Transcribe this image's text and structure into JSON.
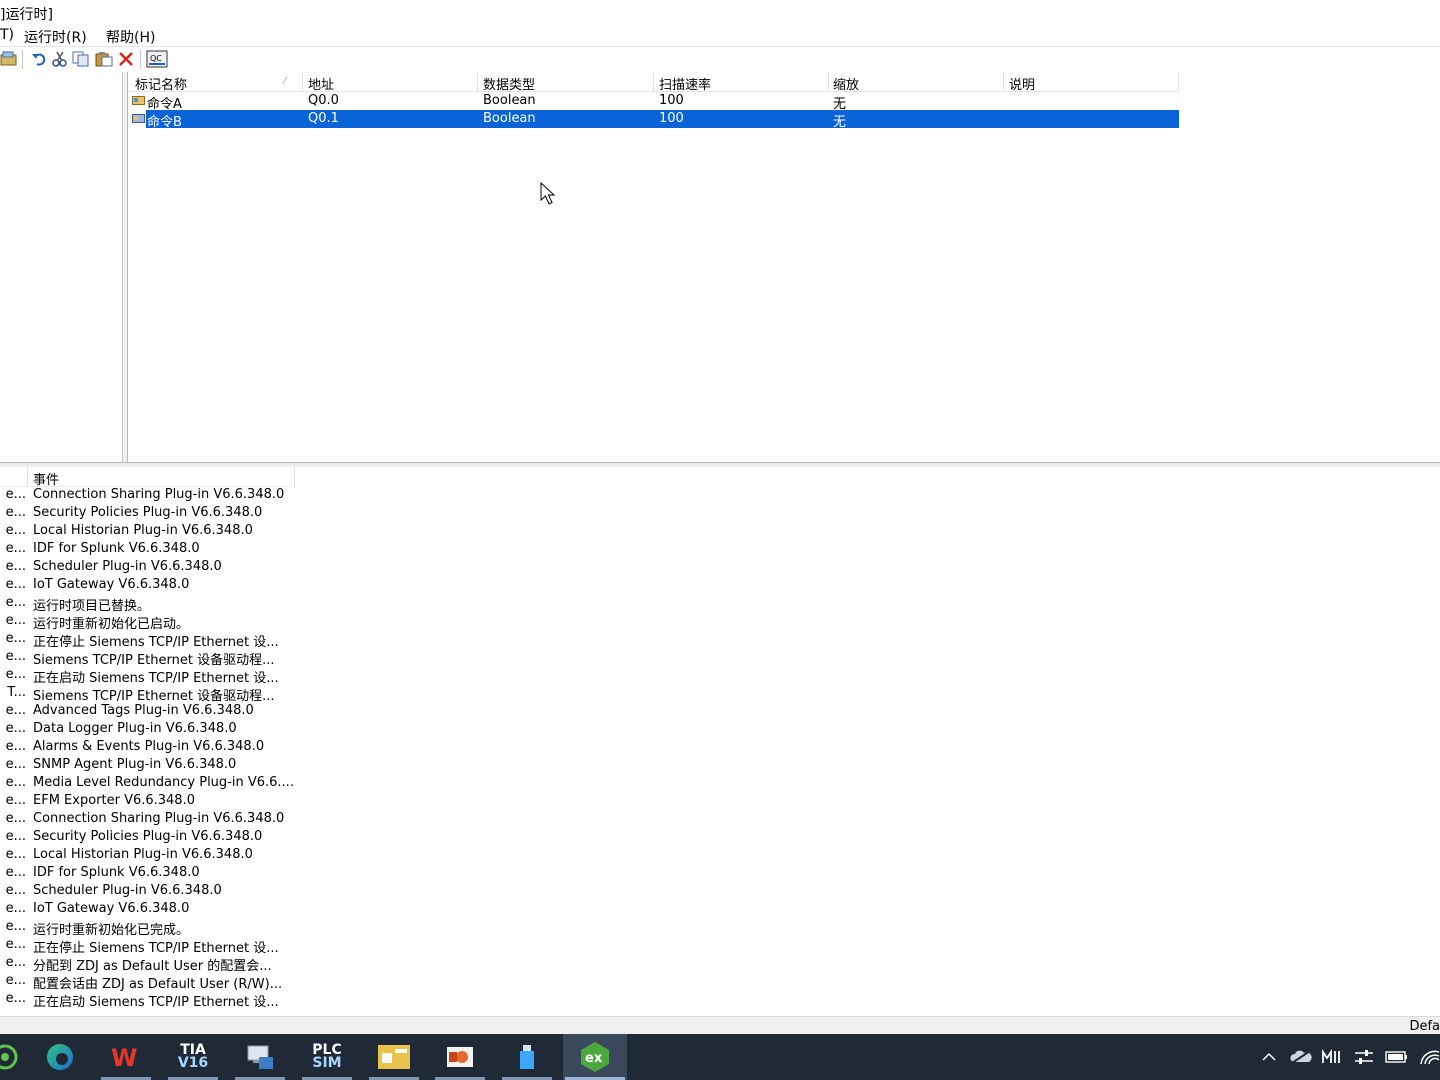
{
  "window": {
    "title": "]运行时]"
  },
  "menu": [
    {
      "label": "T)"
    },
    {
      "label": "运行时(R)"
    },
    {
      "label": "帮助(H)"
    }
  ],
  "toolbar": {
    "buttons": [
      "properties-icon",
      "undo-icon",
      "cut-icon",
      "copy-icon",
      "paste-icon",
      "delete-icon",
      "quick-client-icon"
    ],
    "quick_client_label": "QC"
  },
  "tags": {
    "columns": [
      "标记名称",
      "地址",
      "数据类型",
      "扫描速率",
      "缩放",
      "说明"
    ],
    "rows": [
      {
        "name": "命令A",
        "address": "Q0.0",
        "type": "Boolean",
        "rate": "100",
        "scaling": "无",
        "desc": ""
      },
      {
        "name": "命令B",
        "address": "Q0.1",
        "type": "Boolean",
        "rate": "100",
        "scaling": "无",
        "desc": ""
      }
    ],
    "selected_index": 1,
    "selection_color": "#0a64d8"
  },
  "events": {
    "header": "事件",
    "rows": [
      {
        "src": "e...",
        "msg": "Connection Sharing Plug-in V6.6.348.0"
      },
      {
        "src": "e...",
        "msg": "Security Policies Plug-in V6.6.348.0"
      },
      {
        "src": "e...",
        "msg": "Local Historian Plug-in V6.6.348.0"
      },
      {
        "src": "e...",
        "msg": "IDF for Splunk V6.6.348.0"
      },
      {
        "src": "e...",
        "msg": "Scheduler Plug-in V6.6.348.0"
      },
      {
        "src": "e...",
        "msg": "IoT Gateway V6.6.348.0"
      },
      {
        "src": "e...",
        "msg": "运行时项目已替换。"
      },
      {
        "src": "e...",
        "msg": "运行时重新初始化已启动。"
      },
      {
        "src": "e...",
        "msg": "正在停止 Siemens TCP/IP Ethernet 设..."
      },
      {
        "src": "e...",
        "msg": "Siemens TCP/IP Ethernet 设备驱动程..."
      },
      {
        "src": "e...",
        "msg": "正在启动 Siemens TCP/IP Ethernet 设..."
      },
      {
        "src": "T...",
        "msg": "Siemens TCP/IP Ethernet 设备驱动程..."
      },
      {
        "src": "e...",
        "msg": "Advanced Tags Plug-in V6.6.348.0"
      },
      {
        "src": "e...",
        "msg": "Data Logger Plug-in V6.6.348.0"
      },
      {
        "src": "e...",
        "msg": "Alarms & Events Plug-in V6.6.348.0"
      },
      {
        "src": "e...",
        "msg": "SNMP Agent Plug-in V6.6.348.0"
      },
      {
        "src": "e...",
        "msg": "Media Level Redundancy Plug-in V6.6...."
      },
      {
        "src": "e...",
        "msg": "EFM Exporter V6.6.348.0"
      },
      {
        "src": "e...",
        "msg": "Connection Sharing Plug-in V6.6.348.0"
      },
      {
        "src": "e...",
        "msg": "Security Policies Plug-in V6.6.348.0"
      },
      {
        "src": "e...",
        "msg": "Local Historian Plug-in V6.6.348.0"
      },
      {
        "src": "e...",
        "msg": "IDF for Splunk V6.6.348.0"
      },
      {
        "src": "e...",
        "msg": "Scheduler Plug-in V6.6.348.0"
      },
      {
        "src": "e...",
        "msg": "IoT Gateway V6.6.348.0"
      },
      {
        "src": "e...",
        "msg": "运行时重新初始化已完成。"
      },
      {
        "src": "e...",
        "msg": "正在停止 Siemens TCP/IP Ethernet 设..."
      },
      {
        "src": "e...",
        "msg": "分配到 ZDJ as Default User 的配置会..."
      },
      {
        "src": "e...",
        "msg": "配置会话由 ZDJ as Default User (R/W)..."
      },
      {
        "src": "e...",
        "msg": "正在启动 Siemens TCP/IP Ethernet 设..."
      }
    ]
  },
  "status": {
    "right_text": "Defa"
  },
  "taskbar": {
    "apps": [
      {
        "name": "browser-app-icon",
        "label": ""
      },
      {
        "name": "edge-icon",
        "label": ""
      },
      {
        "name": "wps-icon",
        "label": "W"
      },
      {
        "name": "tia-portal-icon",
        "label_top": "TIA",
        "label_bottom": "V16"
      },
      {
        "name": "network-tool-icon",
        "label": ""
      },
      {
        "name": "plcsim-icon",
        "label_top": "PLC",
        "label_bottom": "SIM"
      },
      {
        "name": "factory-app-icon",
        "label": ""
      },
      {
        "name": "presentation-icon",
        "label": ""
      },
      {
        "name": "usb-tool-icon",
        "label": ""
      },
      {
        "name": "kepserverex-icon",
        "label": "ex"
      }
    ],
    "tray": [
      "chevron-up-icon",
      "onedrive-icon",
      "input-method-icon",
      "settings-sliders-icon",
      "battery-icon",
      "wifi-icon"
    ]
  }
}
